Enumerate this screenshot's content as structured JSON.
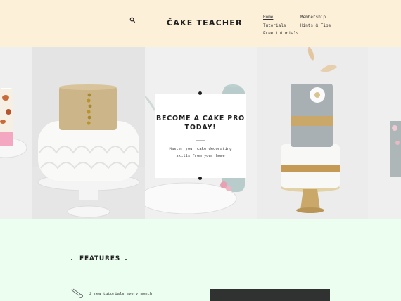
{
  "header": {
    "search": {
      "value": "",
      "placeholder": ""
    },
    "logo": "ČAKE TEACHER",
    "nav": [
      {
        "label": "Home",
        "active": true
      },
      {
        "label": "Membership"
      },
      {
        "label": "Tutorials"
      },
      {
        "label": "Hints & Tips"
      },
      {
        "label": "Free tutorials"
      }
    ]
  },
  "hero": {
    "card_title": "BECOME A CAKE PRO TODAY!",
    "card_text": "Master your cake decorating skills from your home"
  },
  "features": {
    "title": "FEATURES",
    "items": [
      {
        "icon": "piping-bag-icon",
        "text": "2 new tutorials every month"
      }
    ]
  },
  "colors": {
    "header_bg": "#fdf0d9",
    "features_bg": "#ecfef0",
    "text": "#1f1f1f",
    "gold": "#c9a86a"
  }
}
